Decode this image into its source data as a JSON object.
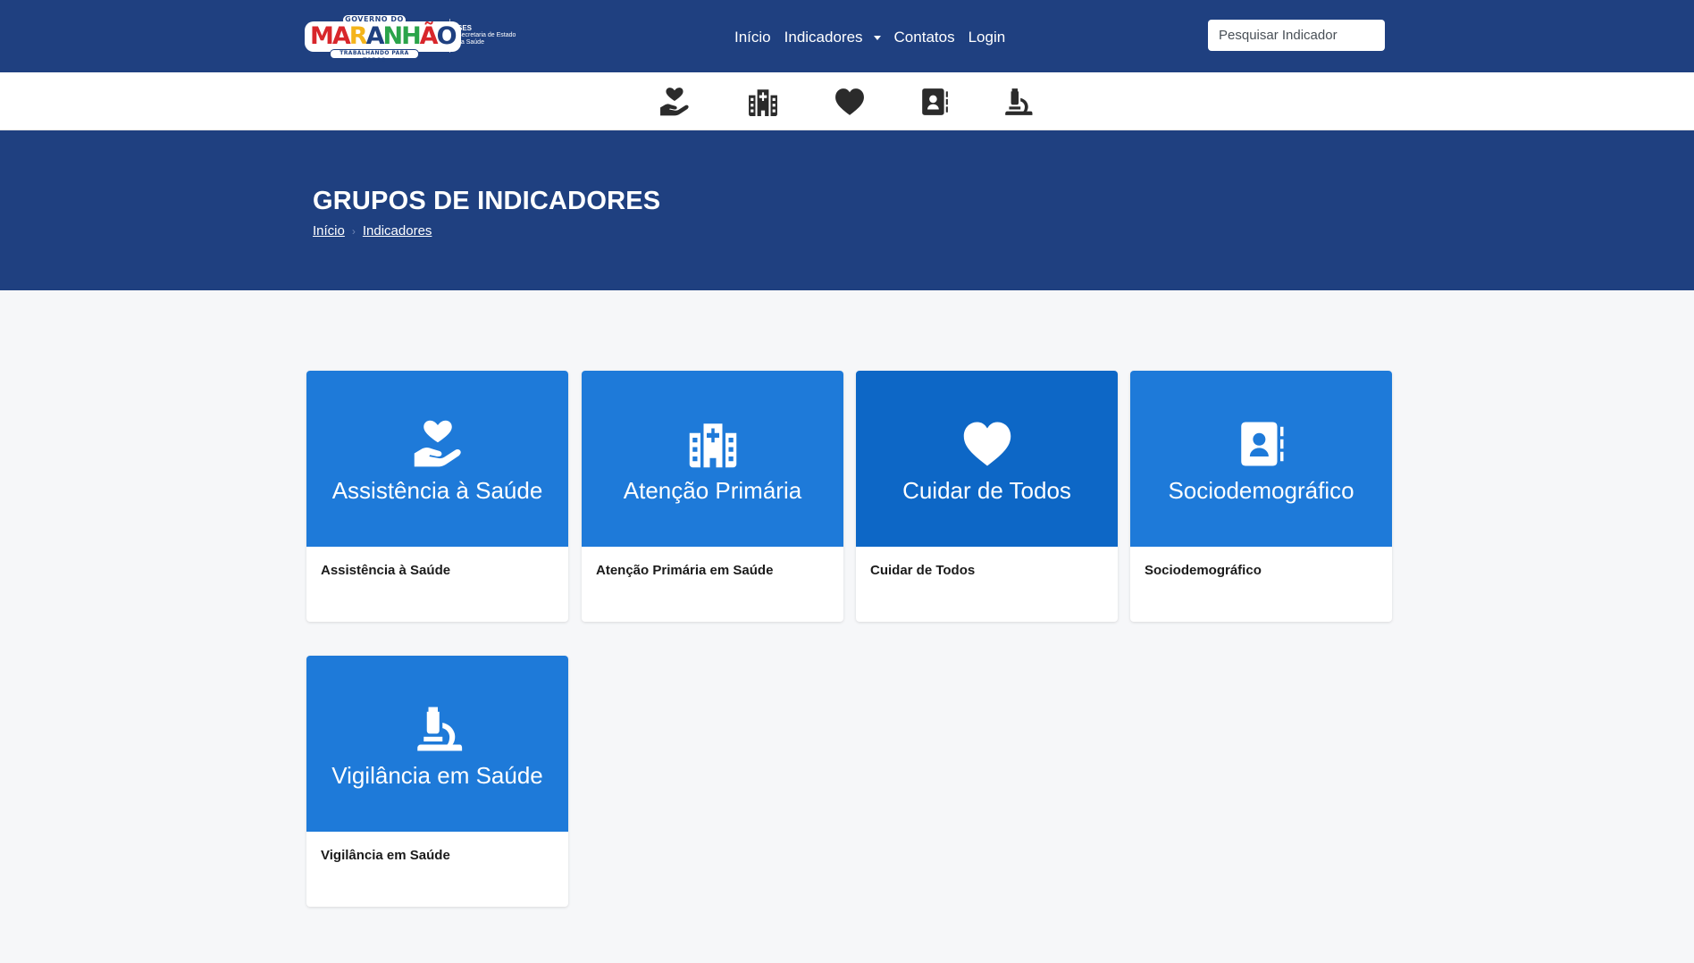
{
  "brand": {
    "top": "GOVERNO DO",
    "word": [
      "MA",
      "R",
      "A",
      "NH",
      "Ã",
      "O"
    ],
    "sub": "TRABALHANDO PARA TODOS",
    "ses_short": "SES",
    "ses_line1": "Secretaria de Estado",
    "ses_line2": "da Saúde"
  },
  "nav": {
    "inicio": "Início",
    "indicadores": "Indicadores",
    "contatos": "Contatos",
    "login": "Login"
  },
  "search": {
    "placeholder": "Pesquisar Indicador"
  },
  "iconbar": [
    "hand-heart-icon",
    "hospital-icon",
    "heart-icon",
    "contact-book-icon",
    "microscope-icon"
  ],
  "hero": {
    "title": "GRUPOS DE INDICADORES",
    "breadcrumb": [
      "Início",
      "Indicadores"
    ]
  },
  "cards": [
    {
      "title": "Assistência à Saúde",
      "desc": "Assistência à Saúde",
      "icon": "hand-heart-icon"
    },
    {
      "title": "Atenção Primária",
      "desc": "Atenção Primária em Saúde",
      "icon": "hospital-icon"
    },
    {
      "title": "Cuidar de Todos",
      "desc": "Cuidar de Todos",
      "icon": "heart-icon"
    },
    {
      "title": "Sociodemográfico",
      "desc": "Sociodemográfico",
      "icon": "contact-book-icon"
    },
    {
      "title": "Vigilância em Saúde",
      "desc": "Vigilância em Saúde",
      "icon": "microscope-icon"
    }
  ],
  "colors": {
    "navy": "#1f4080",
    "card_blue": "#1e7ad9",
    "card_blue_active": "#0d67c6",
    "page_bg": "#f6f7f9"
  }
}
